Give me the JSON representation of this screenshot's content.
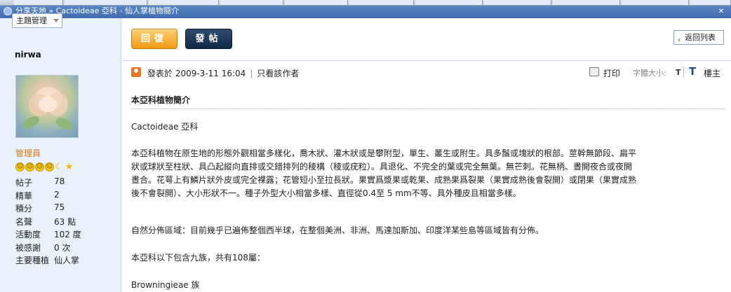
{
  "window": {
    "title": "分享天地 » Cactoideae 亞科 - 仙人掌植物簡介"
  },
  "sidebar": {
    "topic_manage": "主題管理",
    "username": "nirwa",
    "role": "管理員",
    "stats": [
      {
        "k": "帖子",
        "v": "78"
      },
      {
        "k": "精華",
        "v": "2"
      },
      {
        "k": "積分",
        "v": "75"
      },
      {
        "k": "名聲",
        "v": "63 點"
      },
      {
        "k": "活動度",
        "v": "102 度"
      },
      {
        "k": "被感謝",
        "v": "0 次"
      },
      {
        "k": "主要種植",
        "v": "仙人掌"
      }
    ]
  },
  "toolbar": {
    "reply": "回復",
    "post": "發帖",
    "back_list": "返回列表"
  },
  "post": {
    "meta_posted": "發表於 2009-3-11 16:04",
    "meta_author_only": "只看該作者",
    "print": "打印",
    "font_size_label": "字體大小:",
    "font_small": "T",
    "font_big": "T",
    "floor": "樓主",
    "title": "本亞科植物簡介",
    "line1": "Cactoideae 亞科",
    "para_line1": "本亞科植物在原生地的形態外觀相當多樣化，喬木狀、灌木狀或是攀附型，單生、叢生或附生。具多鬚或塊狀的根部。莖幹無節段、扁平",
    "para_line2": "狀或球狀至柱狀、具凸起縱向直排或交錯排列的稜構（稜或疣粒）。具退化、不完全的葉或完全無葉。無芒刺。花無柄、晝開夜合或夜開",
    "para_line3": "晝合。花萼上有鱗片狀外皮或完全裸露；花管短小至拉長狀。果實爲漿果或乾果、成熟果爲裂果（果實成熟後會裂開）或閉果（果實成熟",
    "para_line4": "後不會裂開）、大小形狀不一。種子外型大小相當多樣、直徑從0.4至 5 mm不等、具外種皮且相當多樣。",
    "distribution": "自然分佈區域：目前幾乎已遍佈整個西半球，在整個美洲、非洲、馬達加斯加、印度洋某些島等區域皆有分佈。",
    "tribes": "本亞科以下包含九族，共有108屬：",
    "tribe1": "Browningieae 族"
  },
  "colors": {
    "sidebar_bg": "#e9f1fa",
    "reply_btn": "#f29a17",
    "post_btn": "#102742",
    "role_color": "#d97c1b",
    "accent": "#1f4f82"
  }
}
